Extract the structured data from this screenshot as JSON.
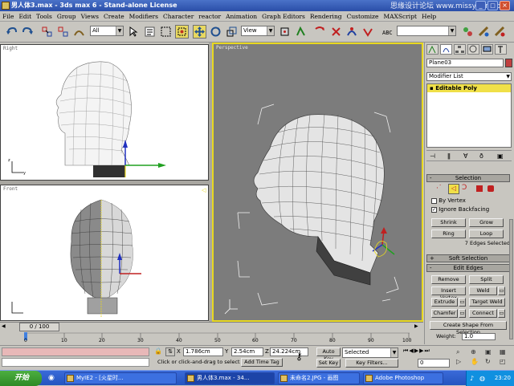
{
  "window": {
    "title": "男人体3.max - 3ds max 6 - Stand-alone License",
    "watermark": "思缘设计论坛 www.missyuan.com"
  },
  "menu": [
    "File",
    "Edit",
    "Tools",
    "Group",
    "Views",
    "Create",
    "Modifiers",
    "Character",
    "reactor",
    "Animation",
    "Graph Editors",
    "Rendering",
    "Customize",
    "MAXScript",
    "Help"
  ],
  "toolbar": {
    "selection_filter": "All",
    "ref_coord": "View",
    "named_sel": ""
  },
  "viewports": {
    "right": "Right",
    "front": "Front",
    "perspective": "Perspective"
  },
  "command_panel": {
    "object_name": "Plane03",
    "modifier_list": "Modifier List",
    "stack_item": "Editable Poly",
    "selection": {
      "title": "Selection",
      "by_vertex": "By Vertex",
      "ignore_backfacing": "Ignore Backfacing",
      "shrink": "Shrink",
      "grow": "Grow",
      "ring": "Ring",
      "loop": "Loop",
      "status": "7 Edges Selected"
    },
    "soft_selection": "Soft Selection",
    "edit_edges": {
      "title": "Edit Edges",
      "remove": "Remove",
      "split": "Split",
      "insert_vertex": "Insert Vertex",
      "weld": "Weld",
      "extrude": "Extrude",
      "target_weld": "Target Weld",
      "chamfer": "Chamfer",
      "connect": "Connect",
      "create_shape": "Create Shape From Selection",
      "weight": "Weight:",
      "weight_value": "1.0"
    }
  },
  "timeline": {
    "frame": "0 / 100",
    "ticks": [
      "0",
      "10",
      "20",
      "30",
      "40",
      "50",
      "60",
      "70",
      "80",
      "90",
      "100"
    ]
  },
  "status": {
    "prompt": "Click or click-and-drag to select obj",
    "add_time_tag": "Add Time Tag",
    "x_label": "X",
    "x": "1.786cm",
    "y_label": "Y",
    "y": "2.54cm",
    "z_label": "Z",
    "z": "24.224cm",
    "auto_key": "Auto Key",
    "key_mode": "Selected",
    "set_key": "Set Key",
    "key_filters": "Key Filters...",
    "frame_field": "0"
  },
  "taskbar": {
    "start": "开始",
    "tasks": [
      "MyIE2 - [火星时...",
      "男人体3.max - 34...",
      "未命名2.JPG - 画图",
      "Adobe Photoshop"
    ],
    "clock": "23:20"
  },
  "colors": {
    "accent": "#e8d820",
    "title": "#2a4ea8",
    "viewport_bg": "#7c7c7c"
  }
}
